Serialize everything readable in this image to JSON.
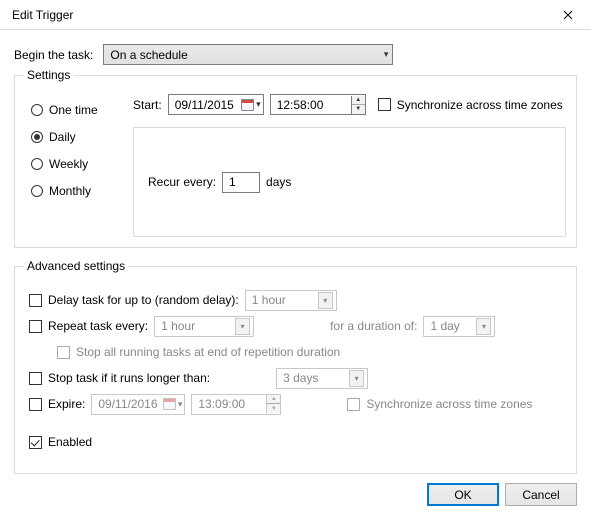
{
  "window": {
    "title": "Edit Trigger"
  },
  "begin": {
    "label": "Begin the task:",
    "selected": "On a schedule"
  },
  "settings": {
    "legend": "Settings",
    "options": {
      "one_time": "One time",
      "daily": "Daily",
      "weekly": "Weekly",
      "monthly": "Monthly"
    },
    "selected": "daily",
    "start_label": "Start:",
    "start_date": "09/11/2015",
    "start_time": "12:58:00",
    "sync_label": "Synchronize across time zones",
    "recur": {
      "label_before": "Recur every:",
      "value": "1",
      "label_after": "days"
    }
  },
  "advanced": {
    "legend": "Advanced settings",
    "delay": {
      "label": "Delay task for up to (random delay):",
      "value": "1 hour"
    },
    "repeat": {
      "label": "Repeat task every:",
      "value": "1 hour",
      "duration_label": "for a duration of:",
      "duration_value": "1 day",
      "stop_label": "Stop all running tasks at end of repetition duration"
    },
    "stop": {
      "label": "Stop task if it runs longer than:",
      "value": "3 days"
    },
    "expire": {
      "label": "Expire:",
      "date": "09/11/2016",
      "time": "13:09:00",
      "sync_label": "Synchronize across time zones"
    },
    "enabled_label": "Enabled"
  },
  "buttons": {
    "ok": "OK",
    "cancel": "Cancel"
  }
}
